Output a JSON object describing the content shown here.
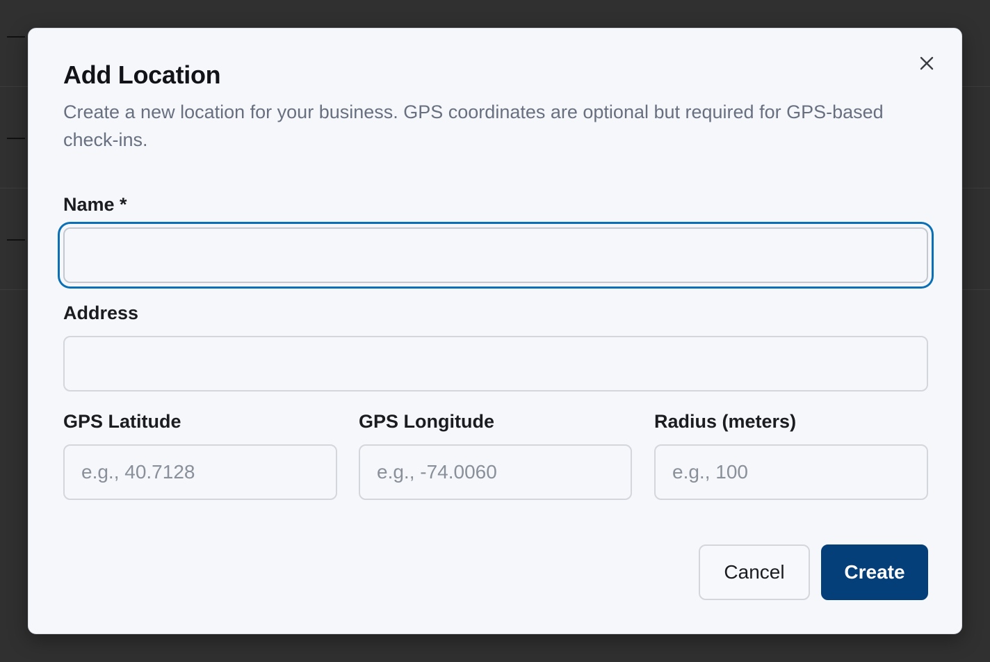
{
  "dialog": {
    "title": "Add Location",
    "description": "Create a new location for your business. GPS coordinates are optional but required for GPS-based check-ins.",
    "close_icon": "close-icon"
  },
  "fields": {
    "name": {
      "label": "Name *",
      "value": "",
      "placeholder": ""
    },
    "address": {
      "label": "Address",
      "value": "",
      "placeholder": ""
    },
    "latitude": {
      "label": "GPS Latitude",
      "value": "",
      "placeholder": "e.g., 40.7128"
    },
    "longitude": {
      "label": "GPS Longitude",
      "value": "",
      "placeholder": "e.g., -74.0060"
    },
    "radius": {
      "label": "Radius (meters)",
      "value": "",
      "placeholder": "e.g., 100"
    }
  },
  "actions": {
    "cancel_label": "Cancel",
    "create_label": "Create"
  },
  "colors": {
    "overlay": "#303030",
    "dialog_bg": "#f5f7fb",
    "focus_ring": "#0a6fb4",
    "primary_button": "#053f7a",
    "muted_text": "#687080"
  }
}
